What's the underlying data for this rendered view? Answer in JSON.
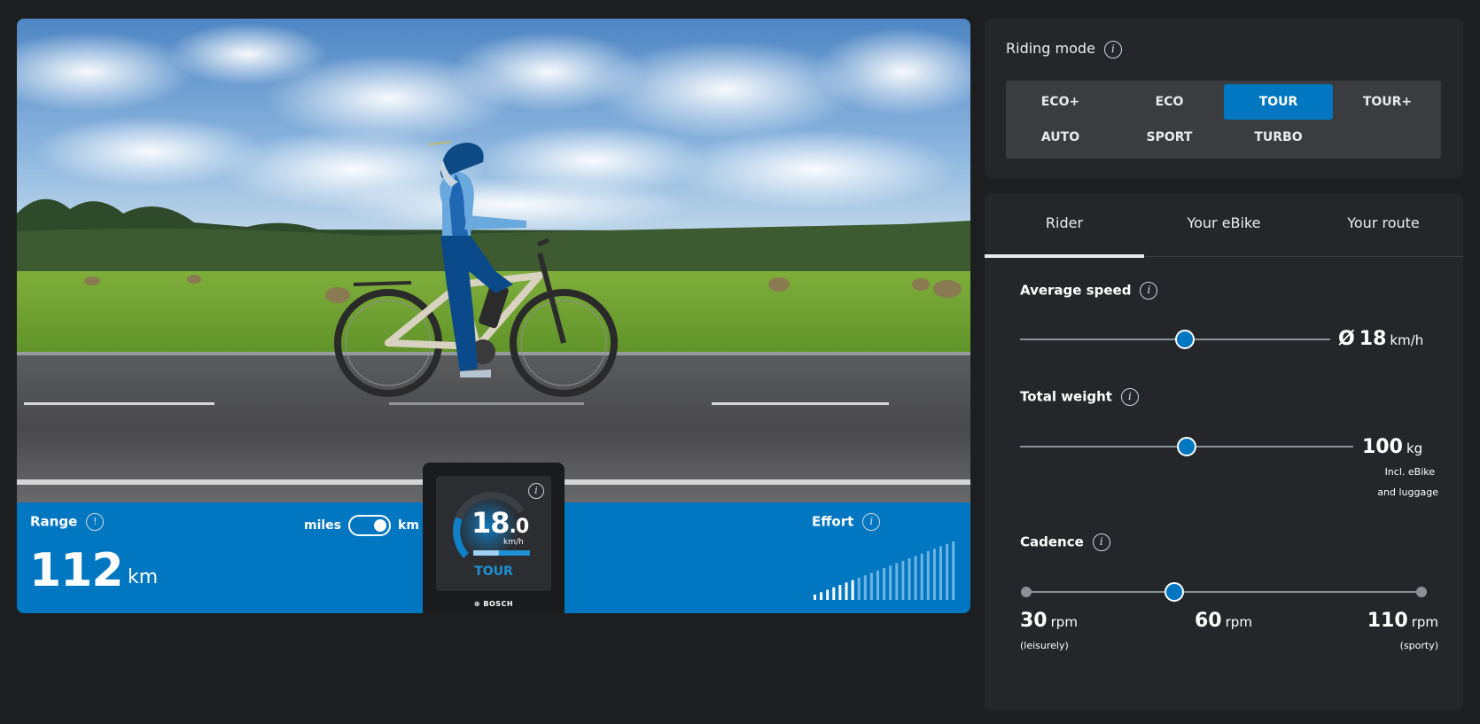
{
  "scene": {
    "range": {
      "label": "Range",
      "value": "112",
      "unit": "km"
    },
    "unit_toggle": {
      "left": "miles",
      "right": "km",
      "selected": "km"
    },
    "effort": {
      "label": "Effort",
      "bars_active": 7,
      "bars_total": 23
    },
    "display": {
      "speed_int": "18",
      "speed_dec": ".0",
      "speed_unit": "km/h",
      "mode": "TOUR",
      "brand": "BOSCH",
      "gauge_level": 0.45
    }
  },
  "riding_mode": {
    "title": "Riding mode",
    "modes": [
      "ECO+",
      "ECO",
      "TOUR",
      "TOUR+",
      "AUTO",
      "SPORT",
      "TURBO"
    ],
    "selected": "TOUR"
  },
  "tabs": [
    "Rider",
    "Your eBike",
    "Your route"
  ],
  "active_tab": "Rider",
  "settings": {
    "average_speed": {
      "label": "Average speed",
      "prefix": "Ø",
      "value": "18",
      "unit": "km/h",
      "level": 0.53
    },
    "total_weight": {
      "label": "Total weight",
      "value": "100",
      "unit": "kg",
      "note_1": "Incl. eBike",
      "note_2": "and luggage",
      "level": 0.5
    },
    "cadence": {
      "label": "Cadence",
      "stops": [
        {
          "value": "30",
          "unit": "rpm",
          "note": "(leisurely)"
        },
        {
          "value": "60",
          "unit": "rpm",
          "note": ""
        },
        {
          "value": "110",
          "unit": "rpm",
          "note": "(sporty)"
        }
      ],
      "level": 0.375
    }
  },
  "colors": {
    "accent": "#0077c0",
    "panel": "#242629",
    "background": "#1c1e20"
  }
}
